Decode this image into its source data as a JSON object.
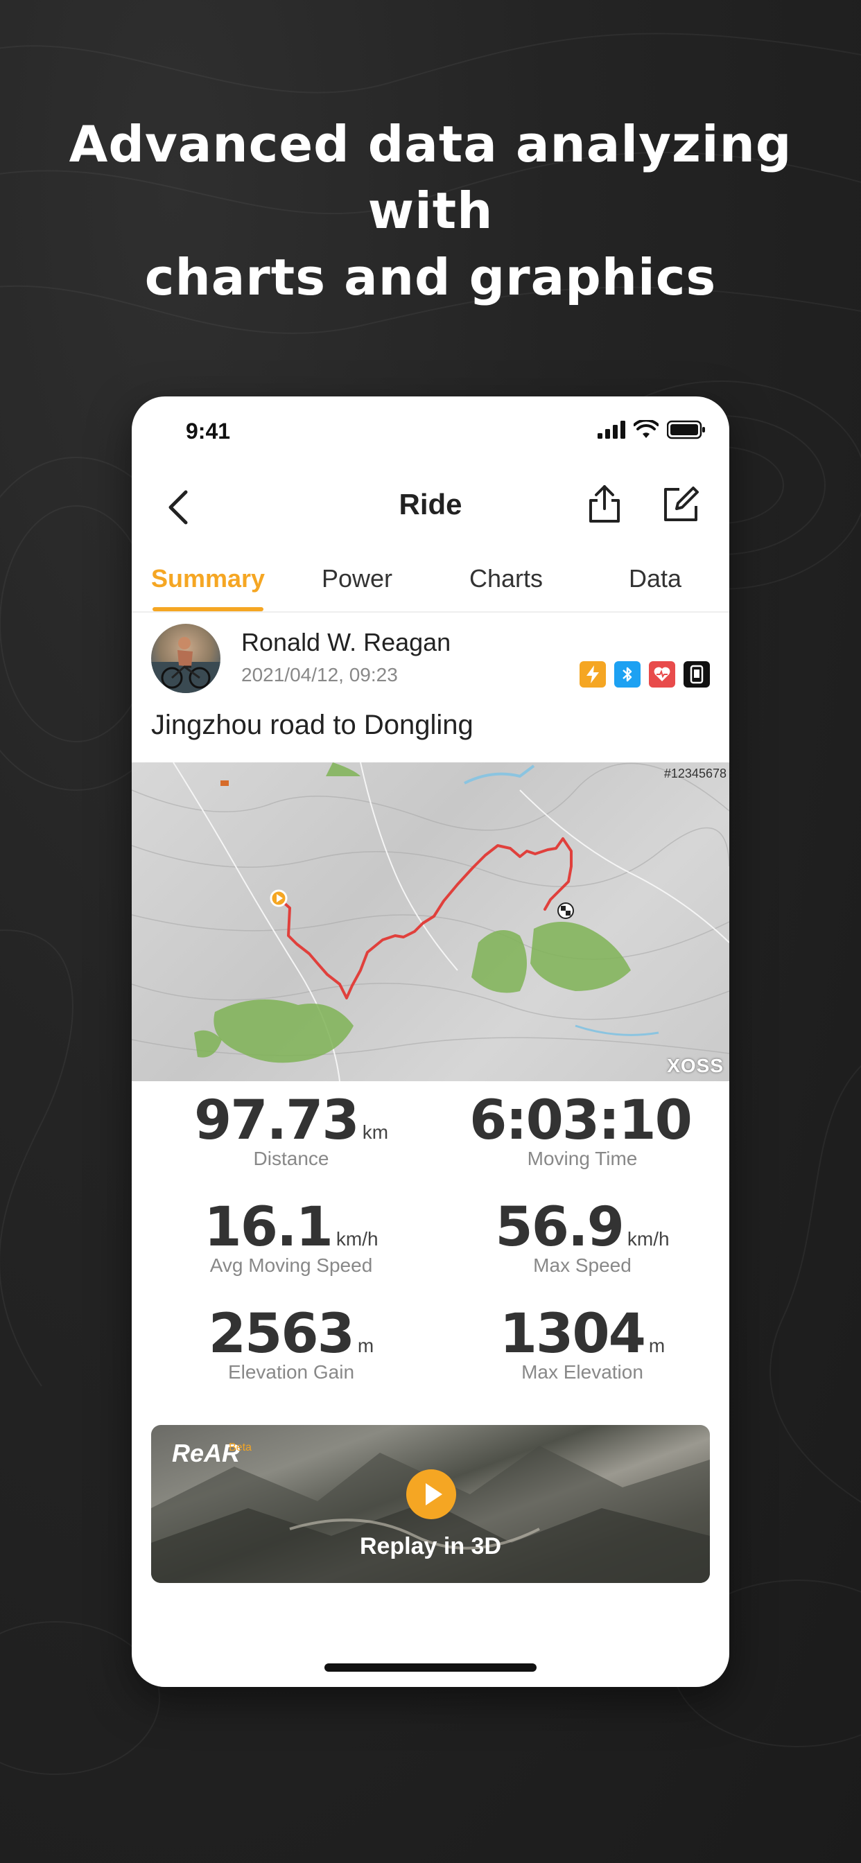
{
  "headline": {
    "line1": "Advanced data analyzing with",
    "line2": "charts and graphics"
  },
  "status_bar": {
    "time": "9:41"
  },
  "nav": {
    "title": "Ride"
  },
  "tabs": [
    {
      "label": "Summary",
      "active": true
    },
    {
      "label": "Power",
      "active": false
    },
    {
      "label": "Charts",
      "active": false
    },
    {
      "label": "Data",
      "active": false
    }
  ],
  "activity": {
    "user_name": "Ronald W. Reagan",
    "datetime": "2021/04/12, 09:23",
    "title": "Jingzhou road to Dongling",
    "badges": [
      {
        "icon": "lightning-icon",
        "color": "#F5A623"
      },
      {
        "icon": "bluetooth-sync-icon",
        "color": "#1DA1F2"
      },
      {
        "icon": "heart-rate-icon",
        "color": "#E84B4B"
      },
      {
        "icon": "bike-computer-icon",
        "color": "#111111"
      }
    ]
  },
  "map": {
    "id_label": "#12345678",
    "brand": "XOSS",
    "route_color": "#E0403C"
  },
  "stats": {
    "distance": {
      "value": "97.73",
      "unit": "km",
      "label": "Distance"
    },
    "moving_time": {
      "value": "6:03:10",
      "unit": "",
      "label": "Moving Time"
    },
    "avg_speed": {
      "value": "16.1",
      "unit": "km/h",
      "label": "Avg Moving Speed"
    },
    "max_speed": {
      "value": "56.9",
      "unit": "km/h",
      "label": "Max Speed"
    },
    "elev_gain": {
      "value": "2563",
      "unit": "m",
      "label": "Elevation Gain"
    },
    "max_elev": {
      "value": "1304",
      "unit": "m",
      "label": "Max Elevation"
    }
  },
  "replay": {
    "logo": "ReAR",
    "beta": "Beta",
    "label": "Replay in 3D"
  },
  "colors": {
    "accent": "#F5A623"
  }
}
